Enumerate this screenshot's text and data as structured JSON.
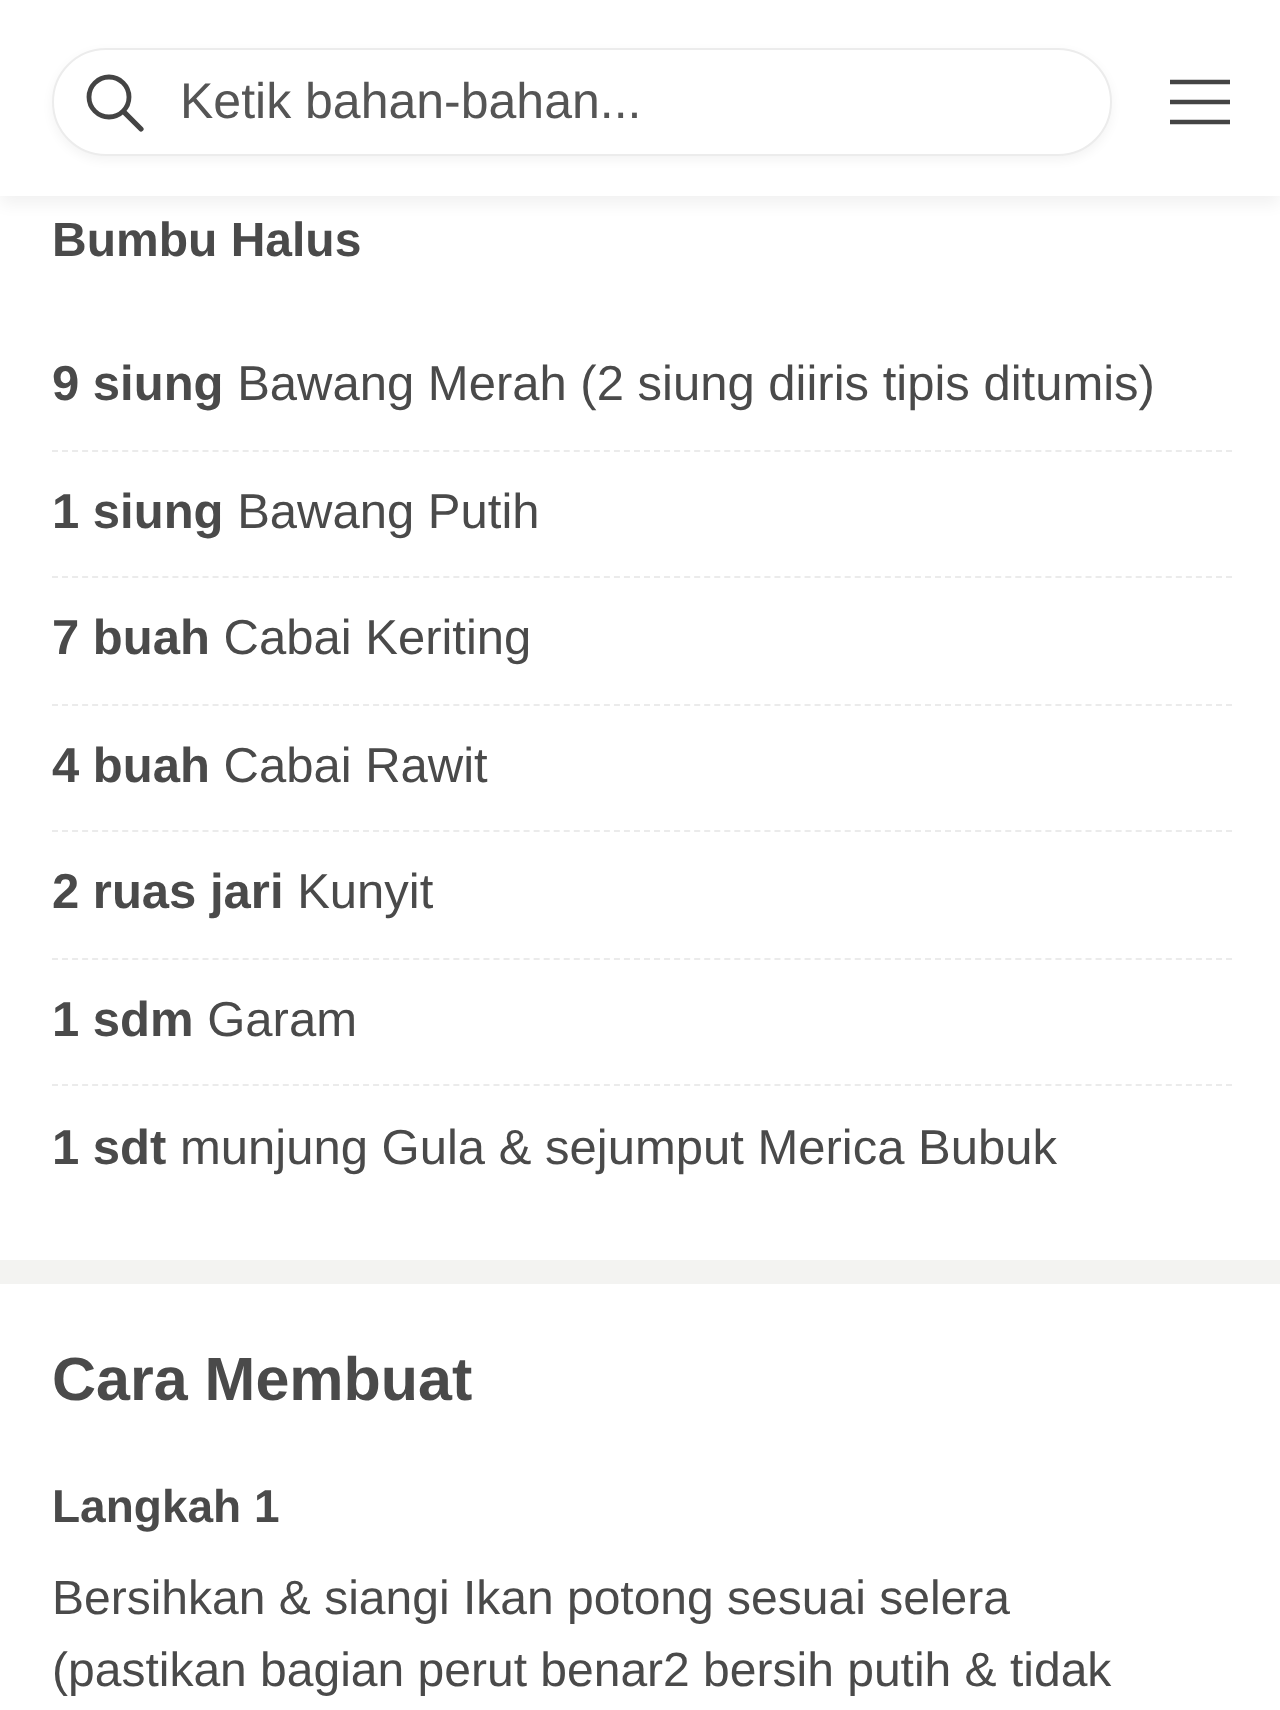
{
  "search": {
    "placeholder": "Ketik bahan-bahan..."
  },
  "ingredients": {
    "section_title": "Bumbu Halus",
    "items": [
      {
        "quantity": "9 siung",
        "name": "Bawang Merah (2 siung diiris tipis ditumis)"
      },
      {
        "quantity": "1 siung",
        "name": "Bawang Putih"
      },
      {
        "quantity": "7 buah",
        "name": "Cabai Keriting"
      },
      {
        "quantity": "4 buah",
        "name": "Cabai Rawit"
      },
      {
        "quantity": "2 ruas jari",
        "name": "Kunyit"
      },
      {
        "quantity": "1 sdm",
        "name": "Garam"
      },
      {
        "quantity": "1 sdt",
        "name": "munjung Gula & sejumput Merica Bubuk"
      }
    ]
  },
  "steps": {
    "title": "Cara Membuat",
    "items": [
      {
        "title": "Langkah 1",
        "text": "Bersihkan & siangi Ikan potong sesuai selera (pastikan bagian perut benar2 bersih putih & tidak"
      }
    ]
  }
}
